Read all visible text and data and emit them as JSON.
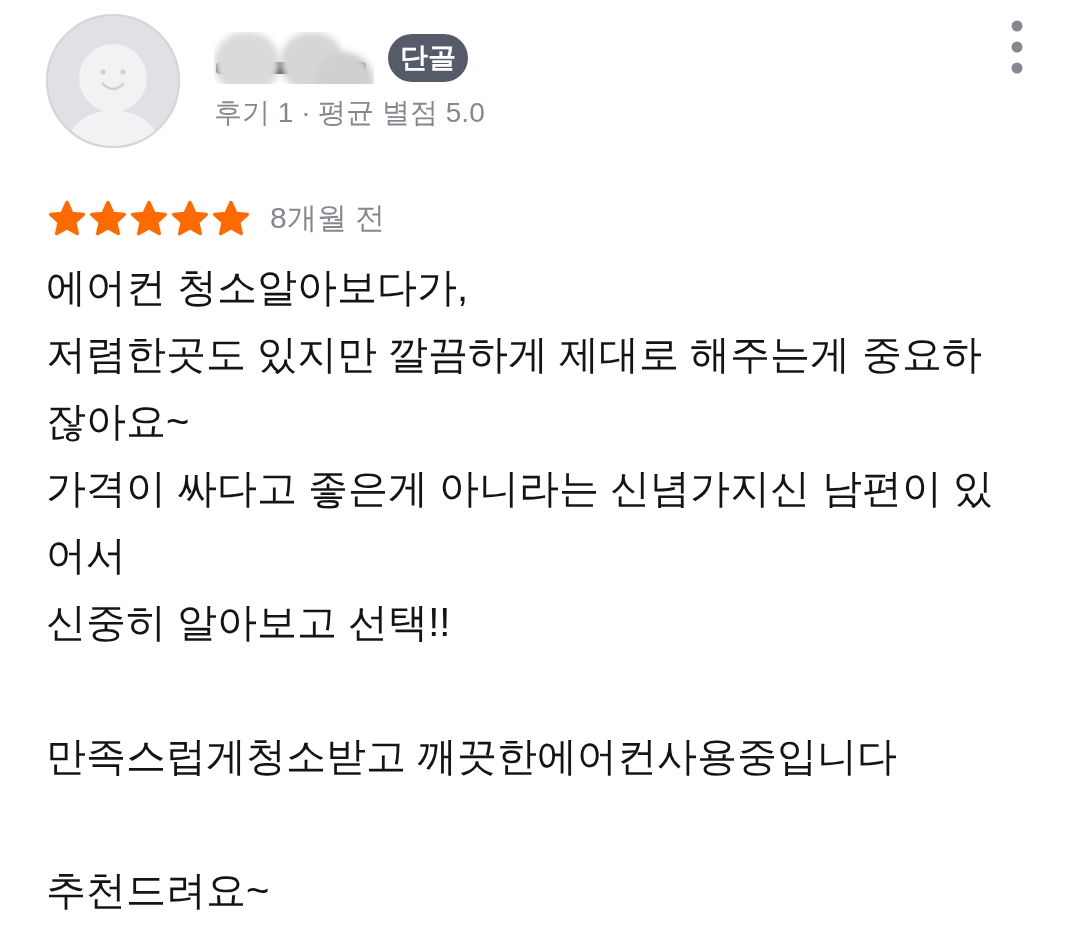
{
  "review": {
    "author": {
      "badge": "단골",
      "stats": "후기 1 · 평균 별점 5.0"
    },
    "stars": 5,
    "time": "8개월 전",
    "text": "에어컨 청소알아보다가,\n저렴한곳도 있지만 깔끔하게 제대로 해주는게 중요하잖아요~\n가격이 싸다고 좋은게 아니라는 신념가지신 남편이 있어서\n신중히 알아보고 선택!!\n\n만족스럽게청소받고 깨끗한에어컨사용중입니다\n\n추천드려요~"
  }
}
